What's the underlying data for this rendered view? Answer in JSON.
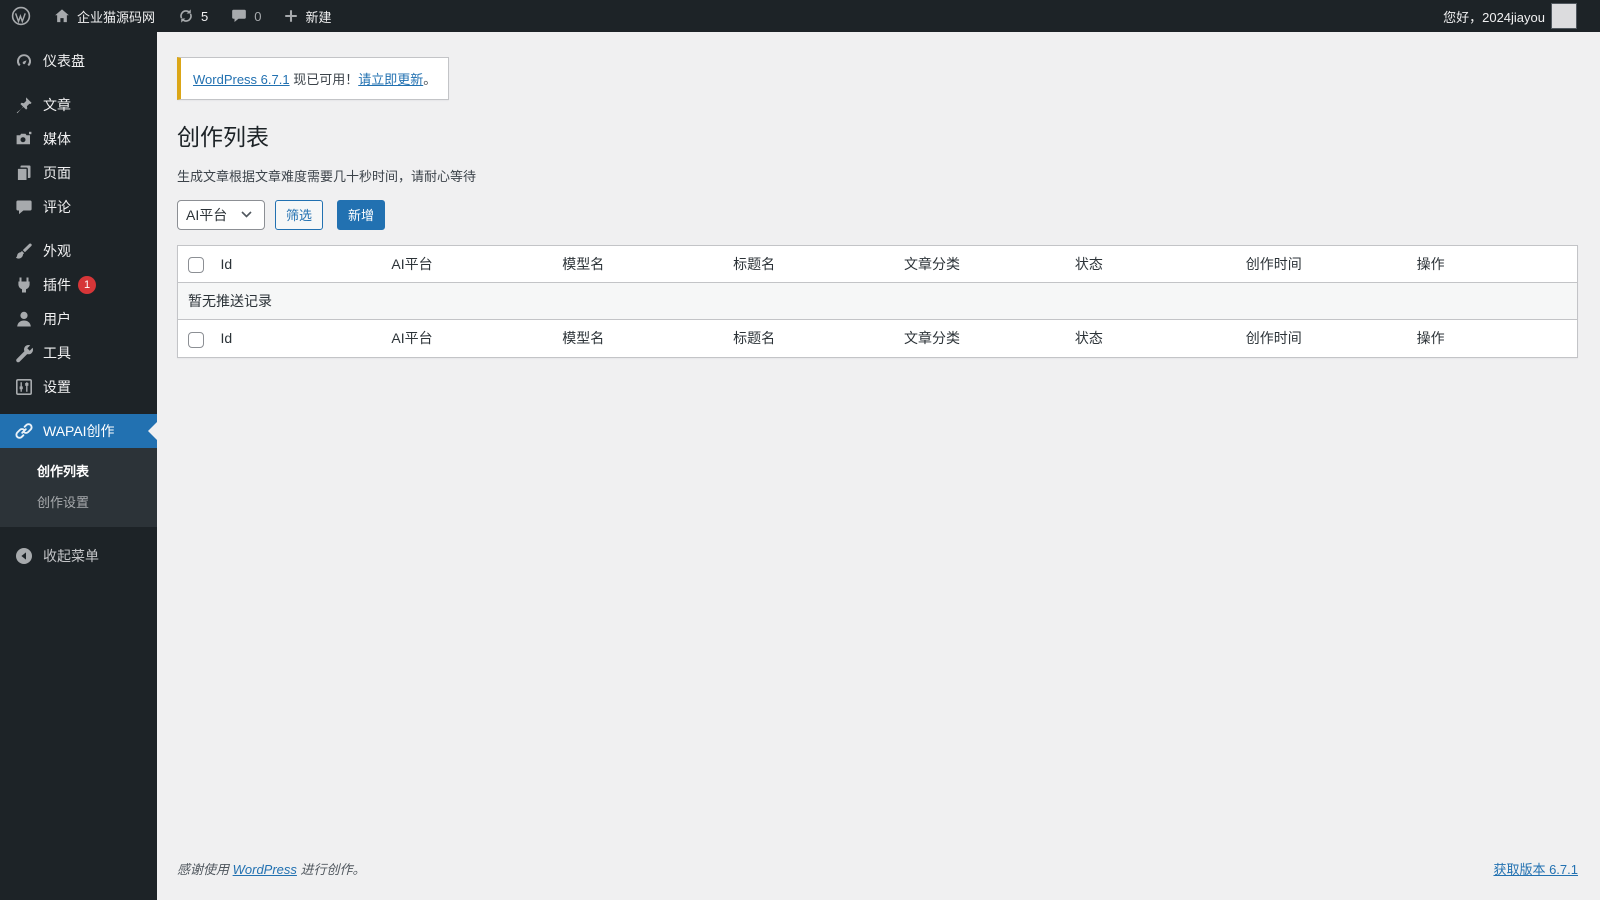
{
  "admin_bar": {
    "site_name": "企业猫源码网",
    "update_count": "5",
    "comment_count": "0",
    "new_label": "新建",
    "greeting": "您好，2024jiayou"
  },
  "sidebar": {
    "items": [
      {
        "label": "仪表盘"
      },
      {
        "label": "文章"
      },
      {
        "label": "媒体"
      },
      {
        "label": "页面"
      },
      {
        "label": "评论"
      },
      {
        "label": "外观"
      },
      {
        "label": "插件",
        "badge": "1"
      },
      {
        "label": "用户"
      },
      {
        "label": "工具"
      },
      {
        "label": "设置"
      },
      {
        "label": "WAPAI创作"
      }
    ],
    "submenu": [
      {
        "label": "创作列表"
      },
      {
        "label": "创作设置"
      }
    ],
    "collapse_label": "收起菜单"
  },
  "notice": {
    "version_link": "WordPress 6.7.1",
    "available_text": " 现已可用！",
    "update_link": "请立即更新",
    "period": "。"
  },
  "page": {
    "title": "创作列表",
    "subtitle": "生成文章根据文章难度需要几十秒时间，请耐心等待"
  },
  "controls": {
    "platform_select_value": "AI平台",
    "filter_label": "筛选",
    "add_label": "新增"
  },
  "table": {
    "columns": [
      "Id",
      "AI平台",
      "模型名",
      "标题名",
      "文章分类",
      "状态",
      "创作时间",
      "操作"
    ],
    "empty_text": "暂无推送记录"
  },
  "footer": {
    "thanks_prefix": "感谢使用 ",
    "thanks_link": "WordPress",
    "thanks_suffix": " 进行创作。",
    "version_link": "获取版本 6.7.1"
  },
  "colors": {
    "accent": "#2271b1",
    "admin_bar_bg": "#1d2327",
    "submenu_bg": "#2c3338",
    "content_bg": "#f0f0f1",
    "notice_accent": "#dba617",
    "badge": "#d63638",
    "table_border": "#c3c4c7",
    "row_alt": "#f6f7f7"
  }
}
